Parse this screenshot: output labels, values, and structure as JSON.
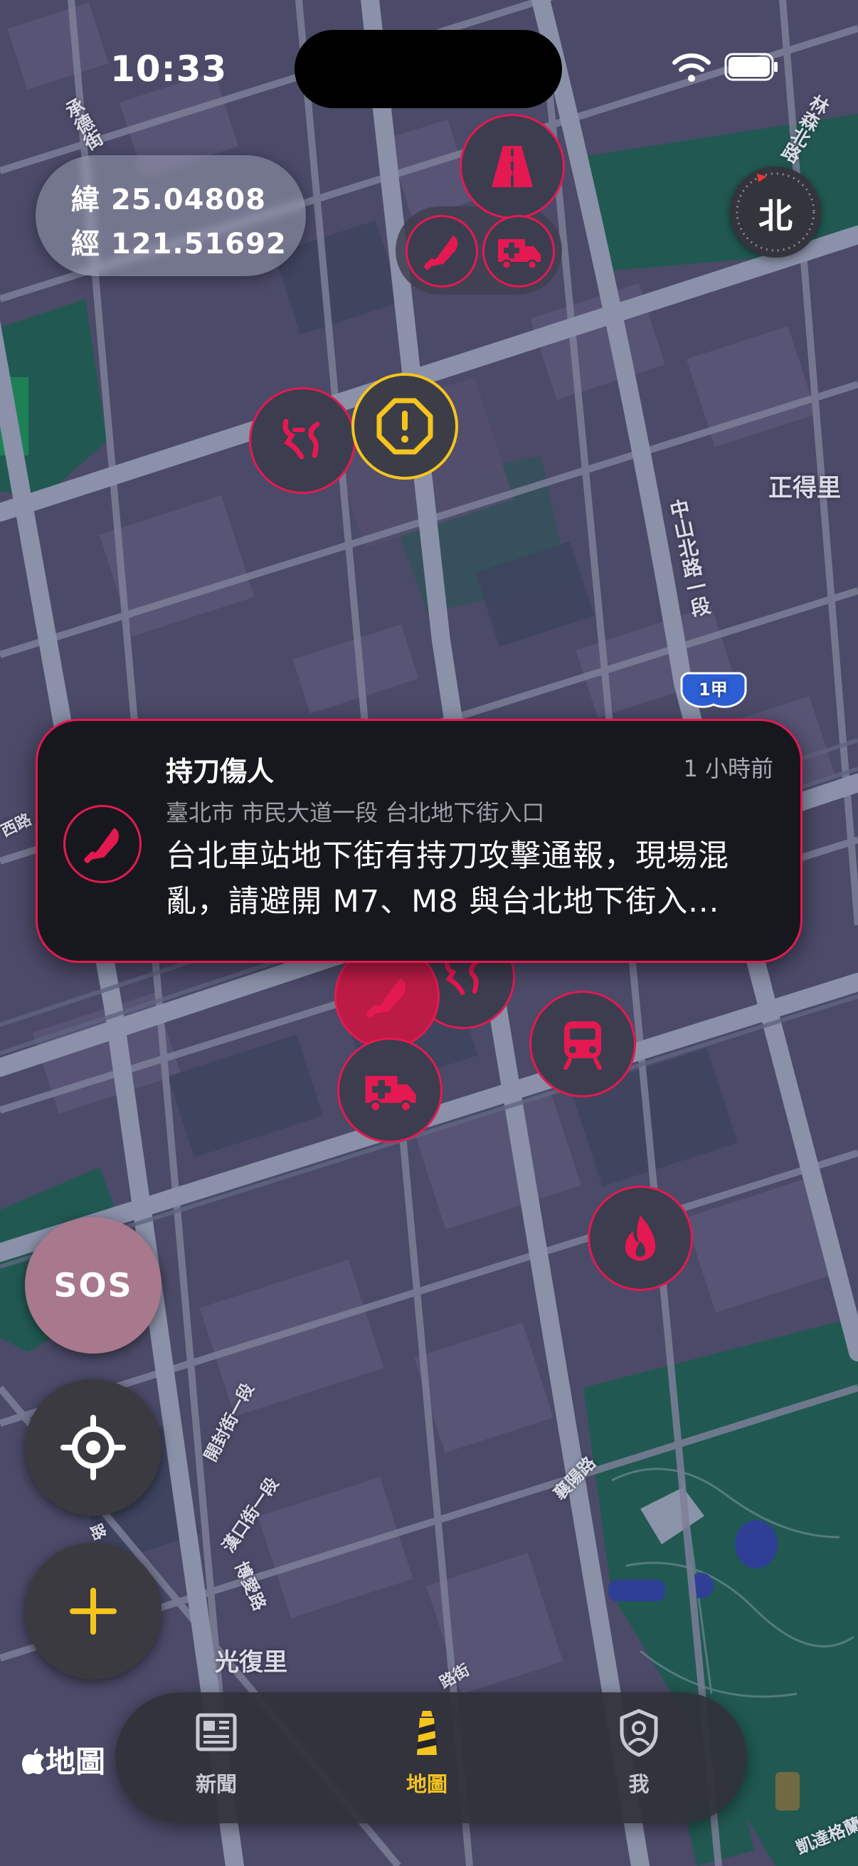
{
  "status_bar": {
    "time": "10:33"
  },
  "coordinates": {
    "lat": "緯 25.04808",
    "lng": "經 121.51692"
  },
  "compass": {
    "label": "北"
  },
  "map_labels": {
    "place_zhengde": "正得里",
    "place_guangfu": "光復里",
    "road_zhongshan": "中山北路一段",
    "road_chengde": "承德街",
    "road_linsen": "林森北路",
    "road_kaifeng": "開封街一段",
    "road_hankou": "漢口街一段",
    "road_xiangyang": "襄陽路",
    "road_boai": "博愛路",
    "road_xi": "西路",
    "road_lu": "路",
    "road_kaida": "凱達格蘭",
    "road_street": "路街",
    "route_shield": "1甲"
  },
  "incident_card": {
    "title": "持刀傷人",
    "time_ago": "1 小時前",
    "address": "臺北市 市民大道一段 台北地下街入口",
    "description_line1": "台北車站地下街有持刀攻擊通報，現場混",
    "description_line2": "亂，請避開 M7、M8 與台北地下街入...",
    "icon": "knife-icon"
  },
  "fabs": {
    "sos_label": "SOS"
  },
  "tab_bar": {
    "tabs": [
      {
        "label": "新聞",
        "icon": "newspaper-icon"
      },
      {
        "label": "地圖",
        "icon": "lighthouse-icon"
      },
      {
        "label": "我",
        "icon": "shield-person-icon"
      }
    ],
    "active_index": 1
  },
  "attribution": {
    "label": "地圖"
  },
  "colors": {
    "alert_red": "#E51951",
    "warning_yellow": "#F5C51D",
    "card_bg": "#17181D"
  }
}
